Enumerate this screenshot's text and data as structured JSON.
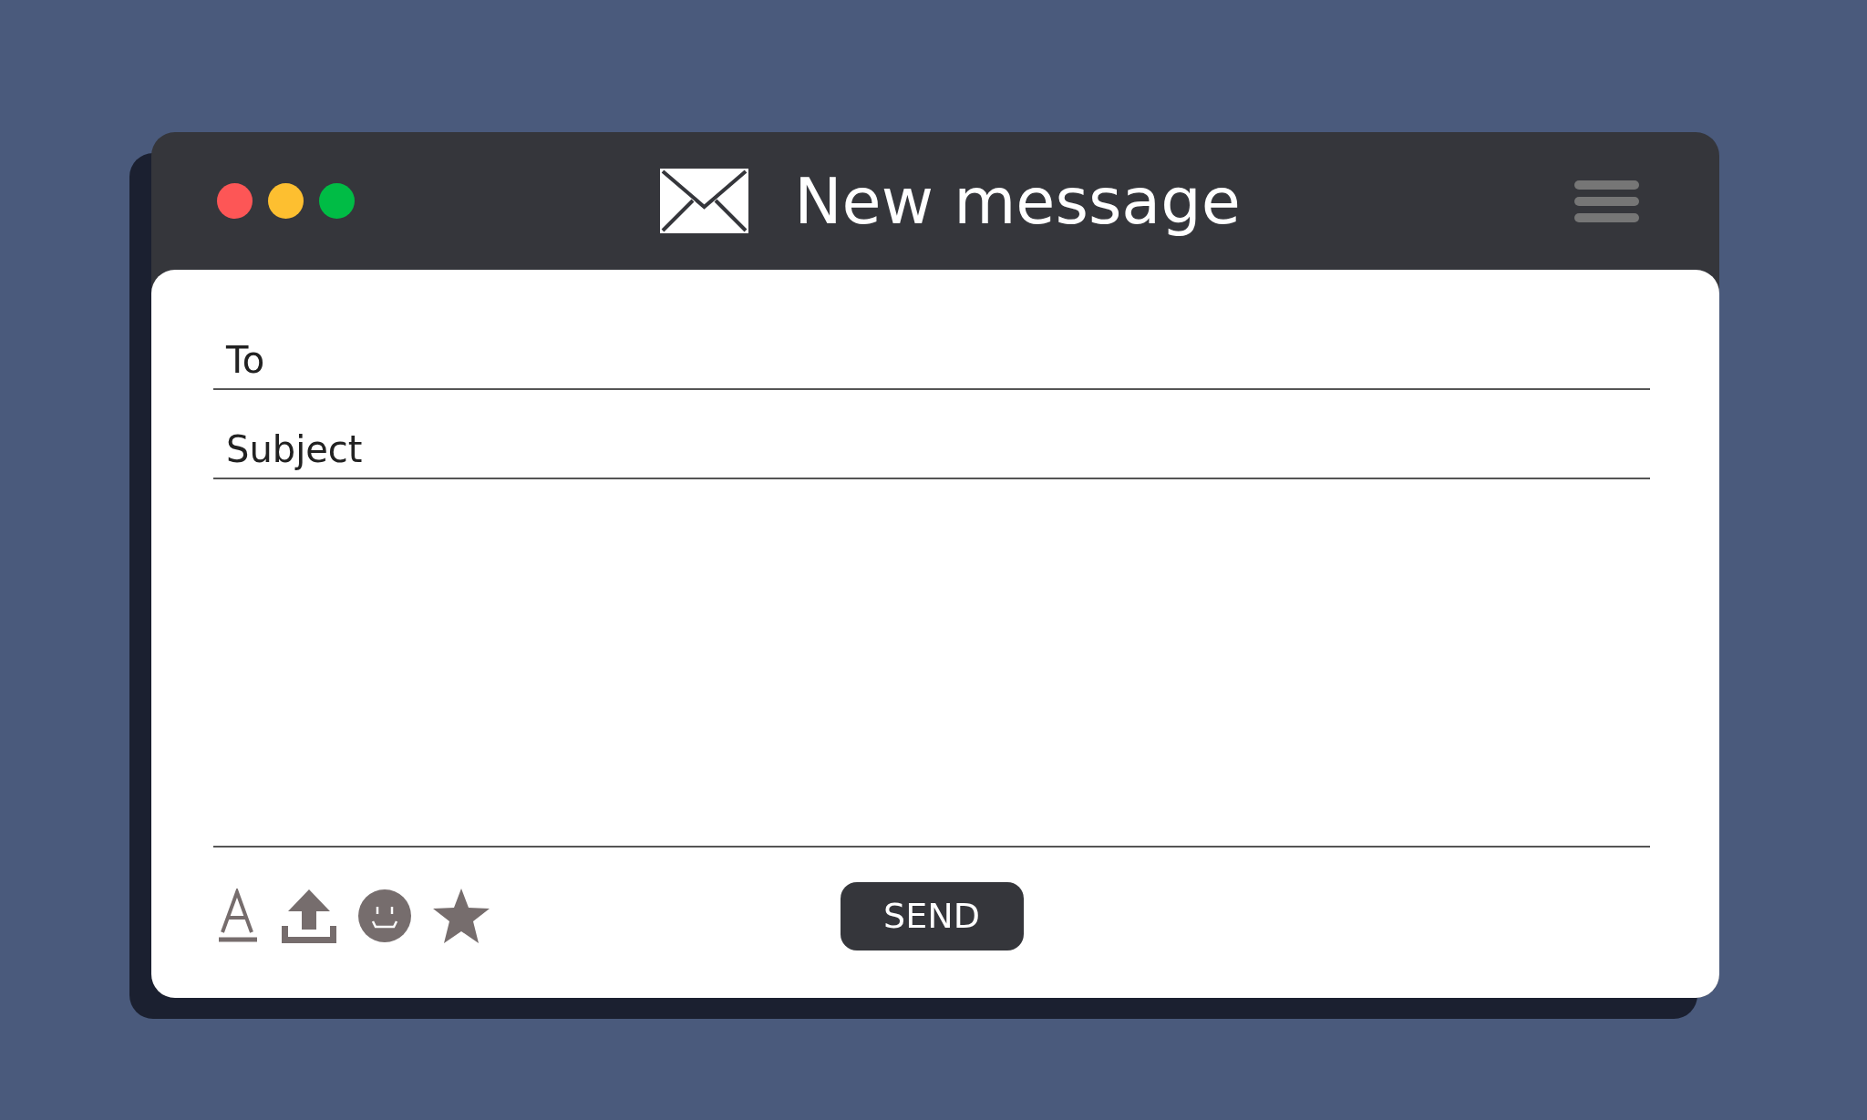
{
  "window": {
    "title": "New message"
  },
  "window_controls": [
    {
      "color": "#fd5656"
    },
    {
      "color": "#fdbf30"
    },
    {
      "color": "#00bc45"
    }
  ],
  "fields": [
    {
      "label": "To"
    },
    {
      "label": "Subject"
    }
  ],
  "toolbar": [
    {
      "kind": "font"
    },
    {
      "kind": "upload"
    },
    {
      "kind": "emoji"
    },
    {
      "kind": "star"
    }
  ],
  "send_button": "SEND"
}
